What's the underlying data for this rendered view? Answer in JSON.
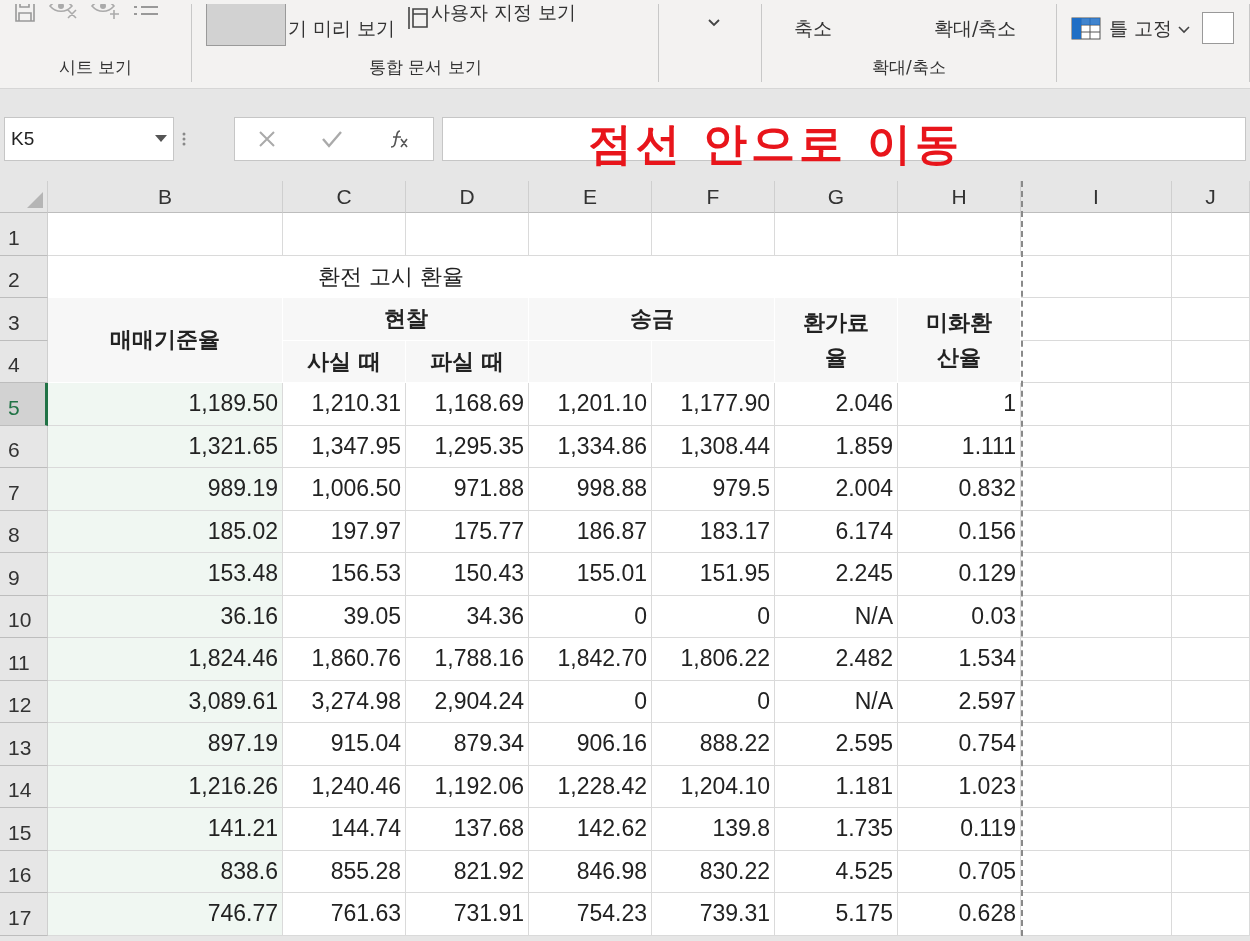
{
  "ribbon": {
    "groups": [
      {
        "kind": "sheet_view",
        "label": "시트 보기"
      },
      {
        "kind": "workbook_view",
        "label": "통합 문서 보기",
        "items": [
          "기 미리 보기",
          "사용자 지정 보기"
        ]
      },
      {
        "kind": "more"
      },
      {
        "kind": "zoom",
        "label": "확대/축소",
        "items": [
          "축소",
          "확대/축소"
        ]
      },
      {
        "kind": "window",
        "items": [
          "틀 고정"
        ]
      }
    ]
  },
  "name_box": "K5",
  "annotation": "점선 안으로 이동",
  "columns": [
    "B",
    "C",
    "D",
    "E",
    "F",
    "G",
    "H",
    "I",
    "J"
  ],
  "row_numbers": [
    {
      "label": "1",
      "selected": false
    },
    {
      "label": "2",
      "selected": false
    },
    {
      "label": "3",
      "selected": false
    },
    {
      "label": "4",
      "selected": false
    },
    {
      "label": "5",
      "selected": true
    },
    {
      "label": "6",
      "selected": false
    },
    {
      "label": "7",
      "selected": false
    },
    {
      "label": "8",
      "selected": false
    },
    {
      "label": "9",
      "selected": false
    },
    {
      "label": "10",
      "selected": false
    },
    {
      "label": "11",
      "selected": false
    },
    {
      "label": "12",
      "selected": false
    },
    {
      "label": "13",
      "selected": false
    },
    {
      "label": "14",
      "selected": false
    },
    {
      "label": "15",
      "selected": false
    },
    {
      "label": "16",
      "selected": false
    },
    {
      "label": "17",
      "selected": false
    }
  ],
  "table": {
    "title": "환전 고시 환율",
    "headers": {
      "base": "매매기준율",
      "cash": "현찰",
      "cash_sub": [
        "사실 때",
        "파실 때"
      ],
      "remit": "송금",
      "fee": [
        "환가료",
        "율"
      ],
      "usd": [
        "미화환",
        "산율"
      ]
    },
    "rows": [
      [
        "1,189.50",
        "1,210.31",
        "1,168.69",
        "1,201.10",
        "1,177.90",
        "2.046",
        "1"
      ],
      [
        "1,321.65",
        "1,347.95",
        "1,295.35",
        "1,334.86",
        "1,308.44",
        "1.859",
        "1.111"
      ],
      [
        "989.19",
        "1,006.50",
        "971.88",
        "998.88",
        "979.5",
        "2.004",
        "0.832"
      ],
      [
        "185.02",
        "197.97",
        "175.77",
        "186.87",
        "183.17",
        "6.174",
        "0.156"
      ],
      [
        "153.48",
        "156.53",
        "150.43",
        "155.01",
        "151.95",
        "2.245",
        "0.129"
      ],
      [
        "36.16",
        "39.05",
        "34.36",
        "0",
        "0",
        "N/A",
        "0.03"
      ],
      [
        "1,824.46",
        "1,860.76",
        "1,788.16",
        "1,842.70",
        "1,806.22",
        "2.482",
        "1.534"
      ],
      [
        "3,089.61",
        "3,274.98",
        "2,904.24",
        "0",
        "0",
        "N/A",
        "2.597"
      ],
      [
        "897.19",
        "915.04",
        "879.34",
        "906.16",
        "888.22",
        "2.595",
        "0.754"
      ],
      [
        "1,216.26",
        "1,240.46",
        "1,192.06",
        "1,228.42",
        "1,204.10",
        "1.181",
        "1.023"
      ],
      [
        "141.21",
        "144.74",
        "137.68",
        "142.62",
        "139.8",
        "1.735",
        "0.119"
      ],
      [
        "838.6",
        "855.28",
        "821.92",
        "846.98",
        "830.22",
        "4.525",
        "0.705"
      ],
      [
        "746.77",
        "761.63",
        "731.91",
        "754.23",
        "739.31",
        "5.175",
        "0.628"
      ]
    ]
  }
}
